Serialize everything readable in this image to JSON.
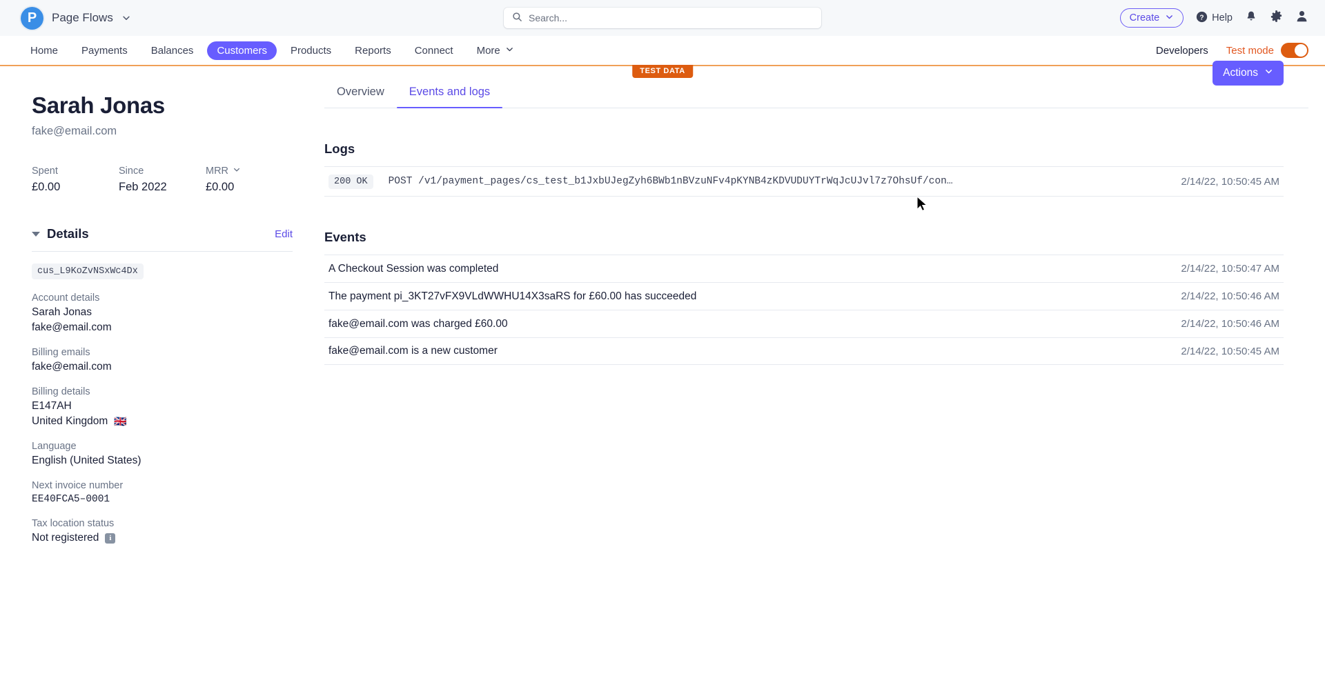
{
  "topbar": {
    "brand_initial": "P",
    "brand_name": "Page Flows",
    "search_placeholder": "Search...",
    "search_value": "",
    "create_label": "Create",
    "help_label": "Help"
  },
  "nav": {
    "items": [
      {
        "label": "Home",
        "active": false
      },
      {
        "label": "Payments",
        "active": false
      },
      {
        "label": "Balances",
        "active": false
      },
      {
        "label": "Customers",
        "active": true
      },
      {
        "label": "Products",
        "active": false
      },
      {
        "label": "Reports",
        "active": false
      },
      {
        "label": "Connect",
        "active": false
      },
      {
        "label": "More",
        "active": false
      }
    ],
    "developers_label": "Developers",
    "test_mode_label": "Test mode",
    "test_mode_on": true,
    "test_data_badge": "TEST DATA"
  },
  "customer": {
    "name": "Sarah Jonas",
    "email": "fake@email.com",
    "stats": [
      {
        "label": "Spent",
        "value": "£0.00",
        "dotted": true,
        "caret": false
      },
      {
        "label": "Since",
        "value": "Feb 2022",
        "dotted": false,
        "caret": false
      },
      {
        "label": "MRR",
        "value": "£0.00",
        "dotted": false,
        "caret": true
      }
    ],
    "details_title": "Details",
    "edit_label": "Edit",
    "customer_id": "cus_L9KoZvNSxWc4Dx",
    "fields": [
      {
        "label": "Account details",
        "values": [
          "Sarah Jonas",
          "fake@email.com"
        ],
        "flag": "",
        "info": false,
        "mono": false
      },
      {
        "label": "Billing emails",
        "values": [
          "fake@email.com"
        ],
        "flag": "",
        "info": false,
        "mono": false
      },
      {
        "label": "Billing details",
        "values": [
          "E147AH",
          "United Kingdom"
        ],
        "flag": "🇬🇧",
        "info": false,
        "mono": false
      },
      {
        "label": "Language",
        "values": [
          "English (United States)"
        ],
        "flag": "",
        "info": false,
        "mono": false
      },
      {
        "label": "Next invoice number",
        "values": [
          "EE40FCA5–0001"
        ],
        "flag": "",
        "info": false,
        "mono": true
      },
      {
        "label": "Tax location status",
        "values": [
          "Not registered"
        ],
        "flag": "",
        "info": true,
        "mono": false
      }
    ]
  },
  "main": {
    "tabs": [
      {
        "label": "Overview",
        "active": false
      },
      {
        "label": "Events and logs",
        "active": true
      }
    ],
    "actions_label": "Actions",
    "logs_title": "Logs",
    "logs": [
      {
        "status": "200 OK",
        "path": "POST /v1/payment_pages/cs_test_b1JxbUJegZyh6BWb1nBVzuNFv4pKYNB4zKDVUDUYTrWqJcUJvl7z7OhsUf/con…",
        "timestamp": "2/14/22, 10:50:45 AM"
      }
    ],
    "events_title": "Events",
    "events": [
      {
        "description": "A Checkout Session was completed",
        "timestamp": "2/14/22, 10:50:47 AM"
      },
      {
        "description": "The payment pi_3KT27vFX9VLdWWHU14X3saRS for £60.00 has succeeded",
        "timestamp": "2/14/22, 10:50:46 AM"
      },
      {
        "description": "fake@email.com was charged £60.00",
        "timestamp": "2/14/22, 10:50:46 AM"
      },
      {
        "description": "fake@email.com is a new customer",
        "timestamp": "2/14/22, 10:50:45 AM"
      }
    ]
  },
  "colors": {
    "accent": "#675dff",
    "link": "#5b4ae6",
    "test_mode": "#dd5c10",
    "muted": "#697386"
  }
}
